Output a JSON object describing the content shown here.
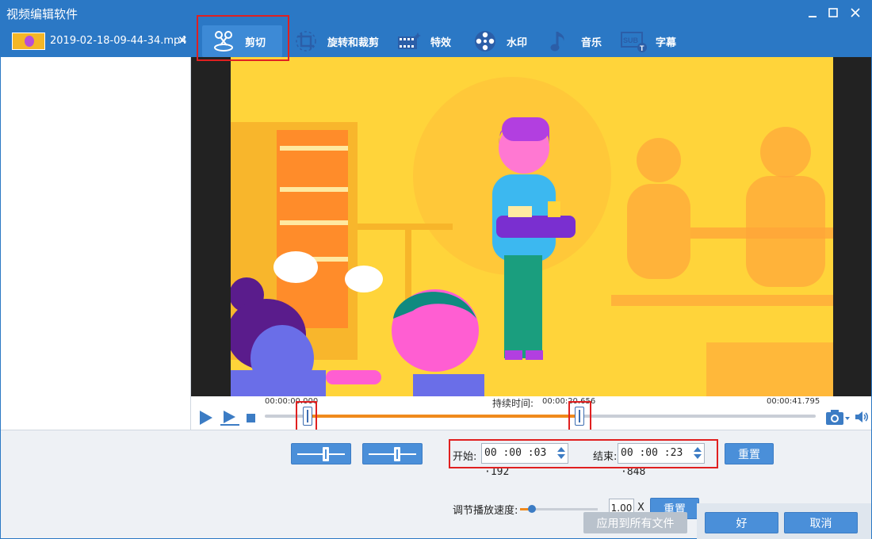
{
  "window": {
    "title": "视频编辑软件"
  },
  "file": {
    "name": "2019-02-18-09-44-34.mp4",
    "close_glyph": "✕"
  },
  "toolbar": {
    "tabs": [
      {
        "label": "剪切",
        "icon": "scissors-icon",
        "active": true
      },
      {
        "label": "旋转和裁剪",
        "icon": "rotate-crop-icon"
      },
      {
        "label": "特效",
        "icon": "film-effect-icon"
      },
      {
        "label": "水印",
        "icon": "watermark-reel-icon"
      },
      {
        "label": "音乐",
        "icon": "music-note-icon"
      },
      {
        "label": "字幕",
        "icon": "subtitle-icon"
      }
    ]
  },
  "timeline": {
    "start_label": "00:00:00.000",
    "duration_label": "持续时间:",
    "duration_value": "00:00:20.656",
    "end_label": "00:00:41.795",
    "selection_start_fraction": 0.077,
    "selection_end_fraction": 0.571
  },
  "trim": {
    "start_label": "开始:",
    "start_value": "00 :00 :03 ·192",
    "end_label": "结束:",
    "end_value": "00 :00 :23 ·848",
    "reset_label": "重置"
  },
  "speed": {
    "label": "调节播放速度:",
    "value": "1.00",
    "unit": "X",
    "reset_label": "重置",
    "slider_fraction": 0.15
  },
  "footer": {
    "apply_all_label": "应用到所有文件",
    "ok_label": "好",
    "cancel_label": "取消"
  },
  "colors": {
    "accent": "#2b78c5",
    "highlight": "#e02020",
    "selection": "#f08a1c",
    "scene_bg": "#ffd43a"
  }
}
